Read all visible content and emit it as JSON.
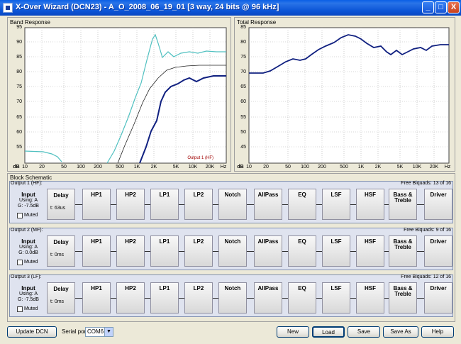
{
  "window": {
    "title": "X-Over Wizard (DCN23) - A_O_2008_06_19_01 [3 way, 24 bits @ 96 kHz]",
    "minimize": "_",
    "maximize": "□",
    "close": "X"
  },
  "band_response": {
    "title": "Band Response",
    "yticks": [
      "95",
      "90",
      "85",
      "80",
      "75",
      "70",
      "65",
      "60",
      "55"
    ],
    "xticks": [
      "10",
      "20",
      "50",
      "100",
      "200",
      "500",
      "1K",
      "2K",
      "5K",
      "10K",
      "20K",
      "Hz"
    ],
    "ylabel": "dB",
    "annotation": "Output 1 (HF)"
  },
  "total_response": {
    "title": "Total Response",
    "yticks": [
      "85",
      "80",
      "75",
      "70",
      "65",
      "60",
      "55",
      "50",
      "45"
    ],
    "xticks": [
      "10",
      "20",
      "50",
      "100",
      "200",
      "500",
      "1K",
      "2K",
      "5K",
      "10K",
      "20K",
      "Hz"
    ],
    "ylabel": "dB"
  },
  "schematic": {
    "title": "Block Schematic",
    "blocks": [
      "HP1",
      "HP2",
      "LP1",
      "LP2",
      "Notch",
      "AllPass",
      "EQ",
      "LSF",
      "HSF",
      "Bass &\nTreble",
      "Driver"
    ],
    "outputs": [
      {
        "label": "Output 1 (HF):",
        "biquads": "Free Biquads: 13 of 16",
        "using": "Using: A",
        "gain": "G: -7.5dB",
        "delay": "t: 63us"
      },
      {
        "label": "Output 2 (MF):",
        "biquads": "Free Biquads: 9 of 16",
        "using": "Using: A",
        "gain": "G: 0.0dB",
        "delay": "t: 0ms"
      },
      {
        "label": "Output 3 (LF):",
        "biquads": "Free Biquads: 12 of 16",
        "using": "Using: A",
        "gain": "G: -7.5dB",
        "delay": "t: 0ms"
      }
    ],
    "input_label": "Input",
    "delay_label": "Delay",
    "muted_label": "Muted"
  },
  "bottom": {
    "update": "Update DCN",
    "serial_label": "Serial port",
    "serial_value": "COM6",
    "new": "New",
    "load": "Load",
    "save": "Save",
    "save_as": "Save As",
    "help": "Help"
  }
}
